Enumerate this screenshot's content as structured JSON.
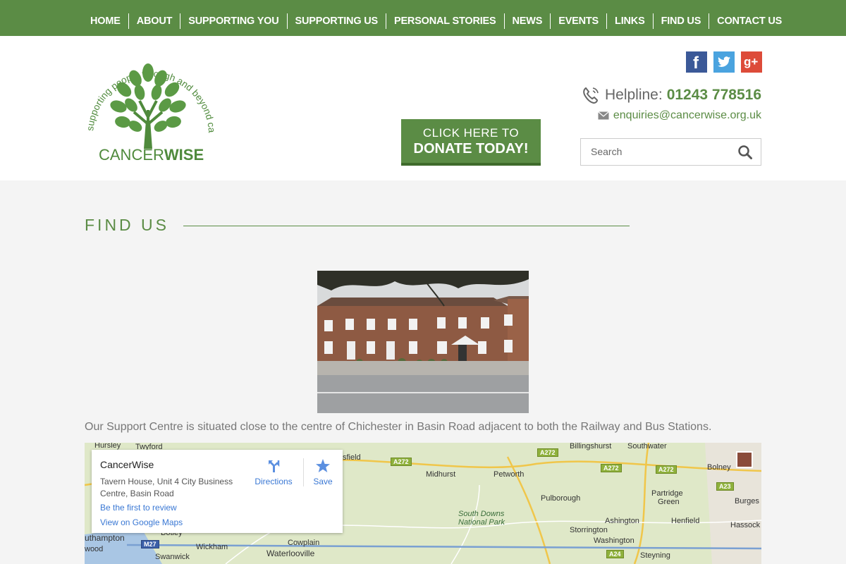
{
  "nav": {
    "items": [
      "HOME",
      "ABOUT",
      "SUPPORTING YOU",
      "SUPPORTING US",
      "PERSONAL STORIES",
      "NEWS",
      "EVENTS",
      "LINKS",
      "FIND US",
      "CONTACT US"
    ]
  },
  "logo": {
    "arc_text": "supporting people through and beyond cancer",
    "word_light": "CANCER",
    "word_bold": "WISE"
  },
  "donate": {
    "line1": "CLICK HERE TO",
    "line2": "DONATE TODAY!"
  },
  "social": {
    "facebook": "f",
    "twitter": "t",
    "googleplus": "g+"
  },
  "contact": {
    "helpline_label": "Helpline:",
    "helpline_number": "01243 778516",
    "email": "enquiries@cancerwise.org.uk"
  },
  "search": {
    "placeholder": "Search"
  },
  "page": {
    "title": "FIND US",
    "description": "Our Support Centre is situated close to the centre of Chichester in Basin Road adjacent to both the Railway and Bus Stations."
  },
  "map": {
    "card": {
      "name": "CancerWise",
      "address": "Tavern House, Unit 4 City Business Centre, Basin Road",
      "directions": "Directions",
      "save": "Save",
      "review": "Be the first to review",
      "view": "View on Google Maps"
    },
    "places": [
      "Hursley",
      "Twyford",
      "sfield",
      "Midhurst",
      "Petworth",
      "Billingshurst",
      "Southwater",
      "Bolney",
      "Partridge",
      "Green",
      "Burges",
      "Pulborough",
      "South Downs",
      "National Park",
      "Ashington",
      "Henfield",
      "Hassock",
      "Storrington",
      "Washington",
      "Steyning",
      "Wickham",
      "Cowplain",
      "Waterlooville",
      "Swanwick",
      "uthampton",
      "Botley",
      "wood"
    ],
    "roads": [
      "A272",
      "A272",
      "A272",
      "A272",
      "A23",
      "A24",
      "M27"
    ]
  },
  "colors": {
    "brand_green": "#5b8c45",
    "link_blue": "#3a78d4"
  }
}
